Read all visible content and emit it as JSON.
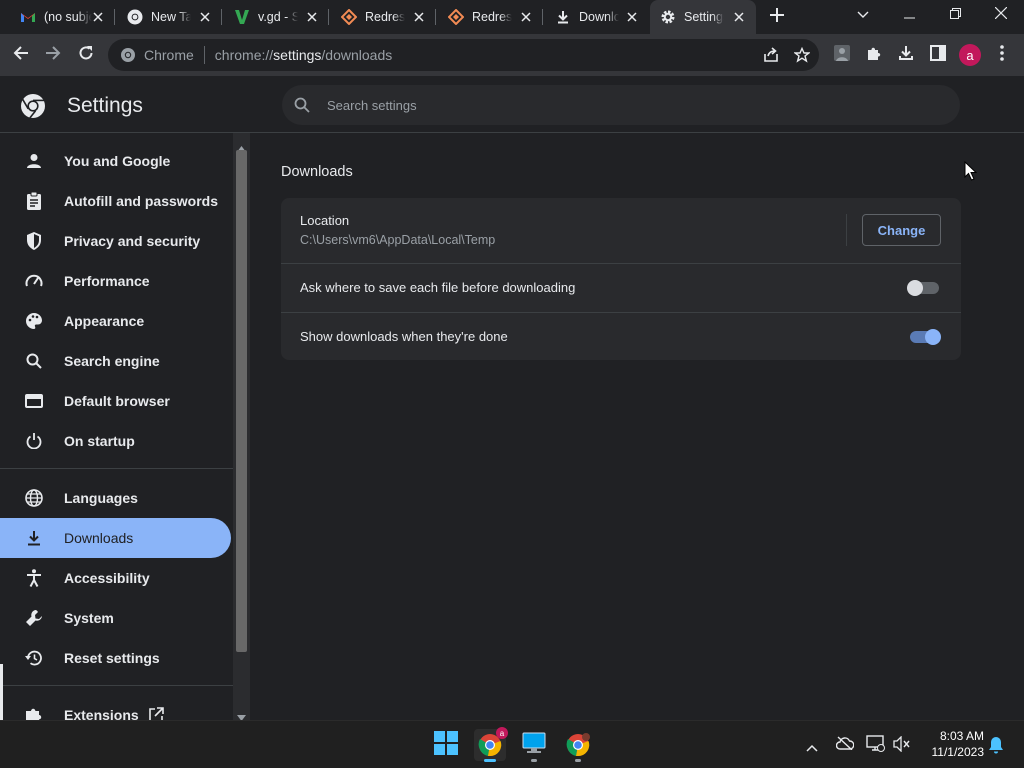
{
  "tabs": [
    {
      "title": "(no subject)",
      "icon": "gmail-icon",
      "closable": true
    },
    {
      "title": "New Tab",
      "icon": "chrome-icon",
      "closable": true
    },
    {
      "title": "v.gd - Shorten",
      "icon": "vgd-icon",
      "closable": true
    },
    {
      "title": "Redress",
      "icon": "redress-icon",
      "closable": true
    },
    {
      "title": "Redress",
      "icon": "redress-icon",
      "closable": true
    },
    {
      "title": "Downloads",
      "icon": "download-icon",
      "closable": true
    },
    {
      "title": "Settings",
      "icon": "gear-icon",
      "closable": true,
      "active": true
    }
  ],
  "omnibox": {
    "chip_label": "Chrome",
    "url_scheme": "chrome://",
    "url_host": "settings",
    "url_path": "/downloads"
  },
  "profile": {
    "initial": "a",
    "color": "#c2185b"
  },
  "settings": {
    "title": "Settings",
    "search_placeholder": "Search settings",
    "nav": [
      {
        "label": "You and Google",
        "icon": "person-icon"
      },
      {
        "label": "Autofill and passwords",
        "icon": "clipboard-icon"
      },
      {
        "label": "Privacy and security",
        "icon": "shield-icon"
      },
      {
        "label": "Performance",
        "icon": "speedometer-icon"
      },
      {
        "label": "Appearance",
        "icon": "palette-icon"
      },
      {
        "label": "Search engine",
        "icon": "search-icon"
      },
      {
        "label": "Default browser",
        "icon": "browser-icon"
      },
      {
        "label": "On startup",
        "icon": "power-icon"
      },
      {
        "label": "Languages",
        "icon": "globe-icon"
      },
      {
        "label": "Downloads",
        "icon": "download-icon",
        "selected": true
      },
      {
        "label": "Accessibility",
        "icon": "accessibility-icon"
      },
      {
        "label": "System",
        "icon": "wrench-icon"
      },
      {
        "label": "Reset settings",
        "icon": "reset-icon"
      },
      {
        "label": "Extensions",
        "icon": "puzzle-icon"
      }
    ],
    "section_title": "Downloads",
    "location_label": "Location",
    "location_path": "C:\\Users\\vm6\\AppData\\Local\\Temp",
    "change_label": "Change",
    "ask_label": "Ask where to save each file before downloading",
    "ask_enabled": false,
    "show_label": "Show downloads when they're done",
    "show_enabled": true
  },
  "taskbar": {
    "time": "8:03 AM",
    "date": "11/1/2023"
  },
  "colors": {
    "accent": "#8ab4f8",
    "toggle_on": "#8ab4f8",
    "toggle_off": "#dadce0"
  }
}
